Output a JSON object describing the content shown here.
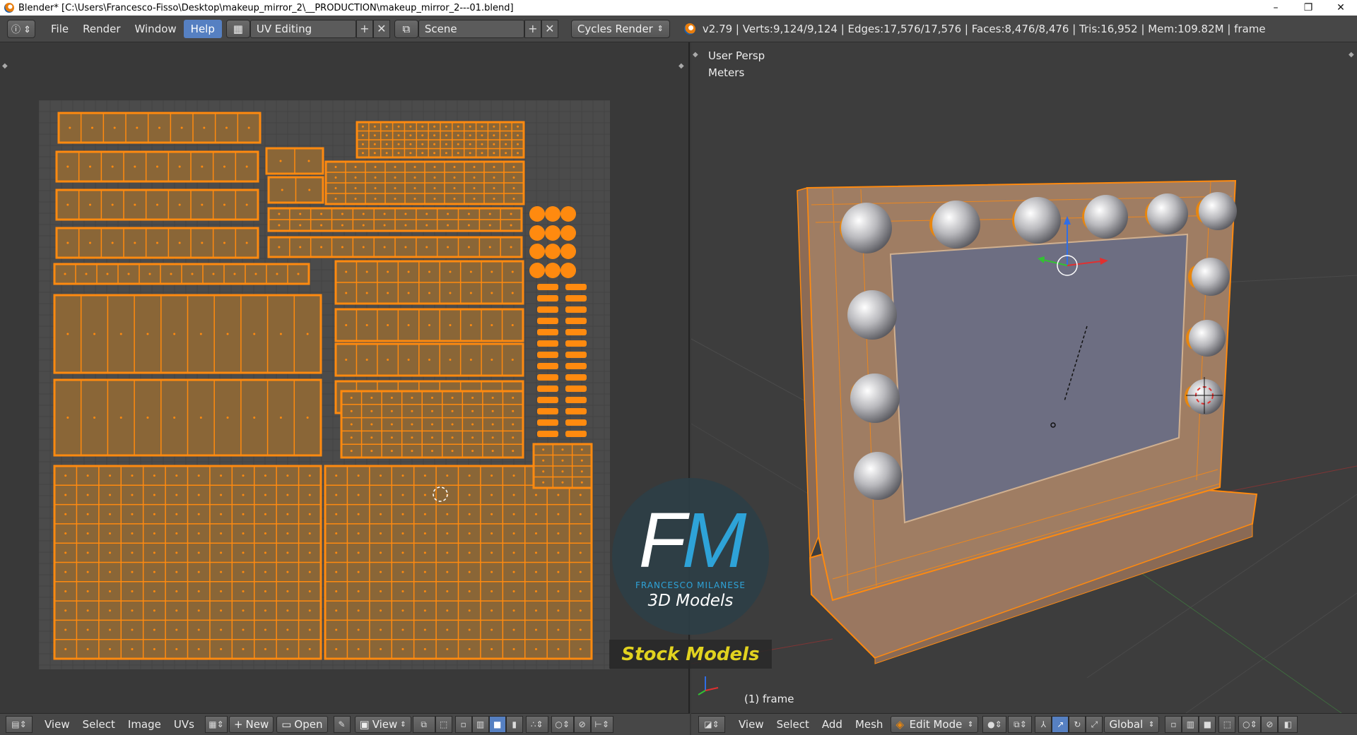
{
  "window": {
    "title": "Blender* [C:\\Users\\Francesco-Fisso\\Desktop\\makeup_mirror_2\\__PRODUCTION\\makeup_mirror_2---01.blend]",
    "minimize": "–",
    "maximize": "❐",
    "close": "✕"
  },
  "topbar": {
    "menus": [
      "File",
      "Render",
      "Window",
      "Help"
    ],
    "active_menu": "Help",
    "screen_layout": "UV Editing",
    "scene": "Scene",
    "render_engine": "Cycles Render",
    "stats": "v2.79 | Verts:9,124/9,124 | Edges:17,576/17,576 | Faces:8,476/8,476 | Tris:16,952 | Mem:109.82M | frame"
  },
  "view3d": {
    "view_name": "User Persp",
    "units": "Meters",
    "frame_label": "(1) frame"
  },
  "uv_footer": {
    "menus": [
      "View",
      "Select",
      "Image",
      "UVs"
    ],
    "new_label": "New",
    "open_label": "Open",
    "view_label": "View"
  },
  "v3d_footer": {
    "menus": [
      "View",
      "Select",
      "Add",
      "Mesh"
    ],
    "mode": "Edit Mode",
    "orientation": "Global"
  },
  "watermark": {
    "fm_f": "F",
    "fm_m": "M",
    "name": "FRANCESCO MILANESE",
    "subtitle": "3D Models",
    "stock": "Stock Models"
  },
  "colors": {
    "uv_orange": "#ff8a0f",
    "uv_fill": "#8a6637",
    "mesh_fill": "#9c7a5f",
    "selected_menu": "#5680c2"
  }
}
